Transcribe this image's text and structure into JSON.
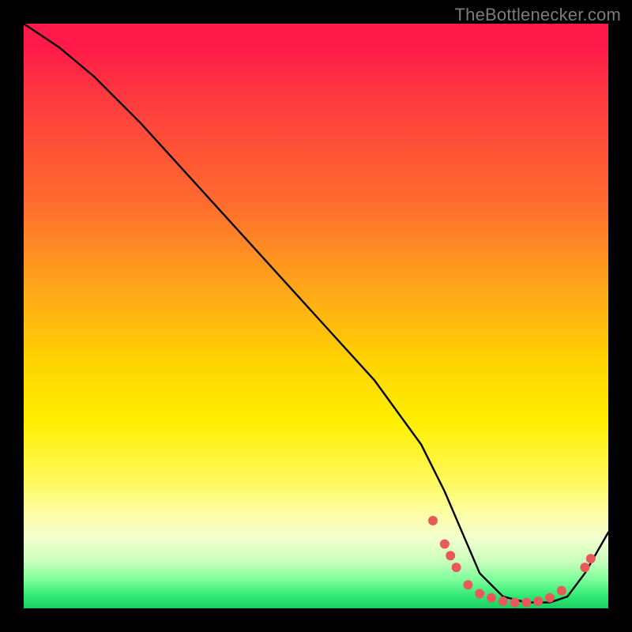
{
  "attribution": "TheBottlenecker.com",
  "chart_data": {
    "type": "line",
    "title": "",
    "xlabel": "",
    "ylabel": "",
    "xlim": [
      0,
      100
    ],
    "ylim": [
      0,
      100
    ],
    "series": [
      {
        "name": "bottleneck-curve",
        "x": [
          0,
          6,
          12,
          20,
          30,
          40,
          50,
          60,
          68,
          72,
          75,
          78,
          82,
          86,
          90,
          93,
          96,
          100
        ],
        "y": [
          100,
          96,
          91,
          83,
          72,
          61,
          50,
          39,
          28,
          20,
          13,
          6,
          2,
          1,
          1,
          2,
          6,
          13
        ]
      }
    ],
    "markers": {
      "name": "highlight-dots",
      "color": "#e85a5a",
      "points": [
        {
          "x": 70,
          "y": 15
        },
        {
          "x": 72,
          "y": 11
        },
        {
          "x": 73,
          "y": 9
        },
        {
          "x": 74,
          "y": 7
        },
        {
          "x": 76,
          "y": 4
        },
        {
          "x": 78,
          "y": 2.5
        },
        {
          "x": 80,
          "y": 1.8
        },
        {
          "x": 82,
          "y": 1.2
        },
        {
          "x": 84,
          "y": 1.0
        },
        {
          "x": 86,
          "y": 1.0
        },
        {
          "x": 88,
          "y": 1.2
        },
        {
          "x": 90,
          "y": 1.8
        },
        {
          "x": 92,
          "y": 3.0
        },
        {
          "x": 96,
          "y": 7.0
        },
        {
          "x": 97,
          "y": 8.5
        }
      ]
    },
    "gradient_stops": [
      {
        "pos": 0.0,
        "color": "#ff1a49"
      },
      {
        "pos": 0.3,
        "color": "#ff6a2f"
      },
      {
        "pos": 0.58,
        "color": "#ffd400"
      },
      {
        "pos": 0.84,
        "color": "#fdffa7"
      },
      {
        "pos": 1.0,
        "color": "#1bcf5f"
      }
    ]
  }
}
